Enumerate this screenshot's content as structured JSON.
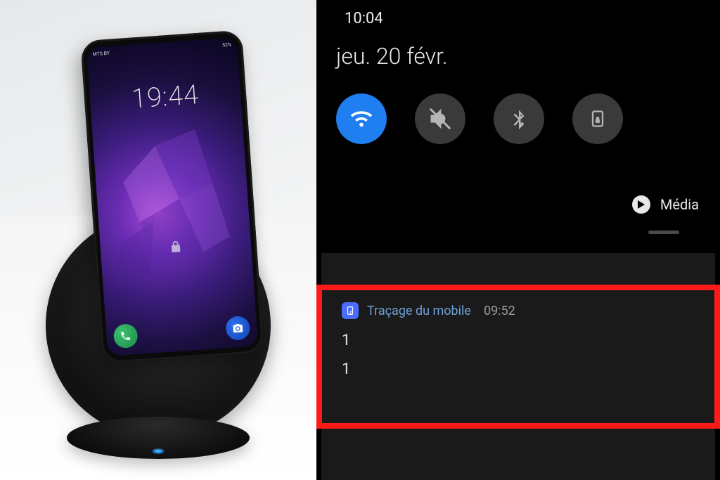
{
  "left_phone": {
    "carrier": "MTS BY",
    "battery": "52%",
    "clock": "19:44",
    "lock_icon": "lock-icon",
    "call_icon": "phone-icon",
    "camera_icon": "camera-icon"
  },
  "right_panel": {
    "status_time": "10:04",
    "date": "jeu. 20 févr.",
    "quick_settings": [
      {
        "name": "wifi",
        "active": true
      },
      {
        "name": "mute",
        "active": false
      },
      {
        "name": "bluetooth",
        "active": false
      },
      {
        "name": "lock-rotation",
        "active": false
      }
    ],
    "media_label": "Média",
    "notification": {
      "app_name": "Traçage du mobile",
      "time": "09:52",
      "line1": "1",
      "line2": "1"
    }
  },
  "colors": {
    "accent": "#1f7ef0",
    "highlight_border": "#ff1a1a"
  }
}
